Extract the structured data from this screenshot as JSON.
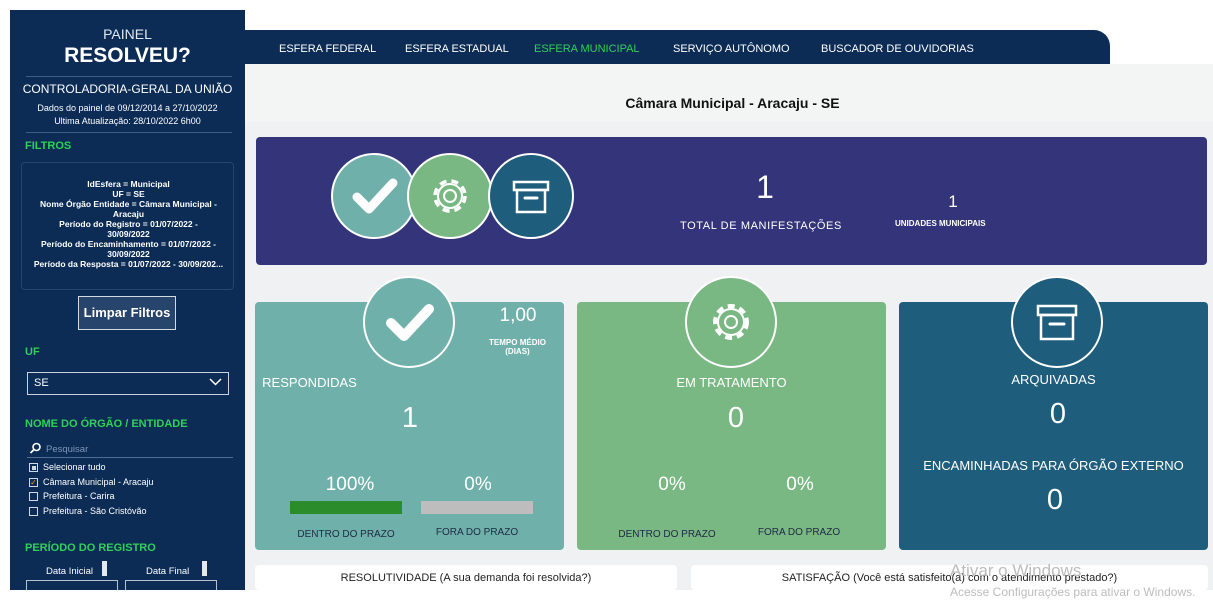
{
  "sidebar": {
    "title_top": "PAINEL",
    "title_main": "RESOLVEU?",
    "org": "CONTROLADORIA-GERAL DA UNIÃO",
    "dates_line1": "Dados do painel de 09/12/2014 a 27/10/2022",
    "dates_line2": "Ultima Atualização: 28/10/2022 6h00",
    "filters_label": "FILTROS",
    "filter_lines": [
      "IdEsfera = Municipal",
      "UF = SE",
      "Nome Órgão Entidade = Câmara Municipal -",
      "Aracaju",
      "Período do Registro = 01/07/2022 -",
      "30/09/2022",
      "Período do Encaminhamento = 01/07/2022 -",
      "30/09/2022",
      "Período da Resposta = 01/07/2022 - 30/09/202..."
    ],
    "clear_button": "Limpar Filtros",
    "uf_label": "UF",
    "uf_value": "SE",
    "org_label": "NOME DO ÓRGÃO / ENTIDADE",
    "search_placeholder": "Pesquisar",
    "org_items": [
      {
        "label": "Selecionar tudo",
        "state": "partial"
      },
      {
        "label": "Câmara Municipal - Aracaju",
        "state": "checked"
      },
      {
        "label": "Prefeitura - Carira",
        "state": "unchecked"
      },
      {
        "label": "Prefeitura - São Cristóvão",
        "state": "unchecked"
      }
    ],
    "period_label": "PERÍODO DO REGISTRO",
    "date_start_label": "Data Inicial",
    "date_end_label": "Data Final"
  },
  "tabs": [
    {
      "label": "ESFERA FEDERAL",
      "active": false
    },
    {
      "label": "ESFERA ESTADUAL",
      "active": false
    },
    {
      "label": "ESFERA MUNICIPAL",
      "active": true
    },
    {
      "label": "SERVIÇO AUTÔNOMO",
      "active": false
    },
    {
      "label": "BUSCADOR DE OUVIDORIAS",
      "active": false
    }
  ],
  "page_title": "Câmara Municipal - Aracaju - SE",
  "banner": {
    "total_value": "1",
    "total_label": "TOTAL DE MANIFESTAÇÕES",
    "units_value": "1",
    "units_label": "UNIDADES MUNICIPAIS"
  },
  "cards": {
    "respondidas": {
      "avg_time": "1,00",
      "avg_time_label_1": "TEMPO MÉDIO",
      "avg_time_label_2": "(DIAS)",
      "title": "RESPONDIDAS",
      "value": "1",
      "in_pct": "100%",
      "out_pct": "0%",
      "in_label": "DENTRO DO PRAZO",
      "out_label": "FORA DO PRAZO",
      "in_fill": 1.0,
      "out_fill": 0.0
    },
    "tratamento": {
      "title": "EM TRATAMENTO",
      "value": "0",
      "in_pct": "0%",
      "out_pct": "0%",
      "in_label": "DENTRO DO PRAZO",
      "out_label": "FORA DO PRAZO"
    },
    "arquivadas": {
      "title": "ARQUIVADAS",
      "value": "0",
      "sub_title": "ENCAMINHADAS PARA ÓRGÃO EXTERNO",
      "sub_value": "0"
    }
  },
  "bottom": {
    "resolutividade": "RESOLUTIVIDADE (A sua demanda foi resolvida?)",
    "satisfacao": "SATISFAÇÃO (Você está satisfeito(a) com o atendimento prestado?)"
  },
  "watermark": {
    "line1": "Ativar o Windows",
    "line2": "Acesse Configurações para ativar o Windows."
  },
  "colors": {
    "sidebar": "#0c2c56",
    "accent_green": "#2fd158",
    "banner": "#34347a",
    "card_respondidas": "#6fb0aa",
    "card_tratamento": "#79b783",
    "card_arquivadas": "#1e5d7c"
  },
  "icons": [
    "check-icon",
    "gear-icon",
    "archive-box-icon",
    "search-icon",
    "chevron-down-icon"
  ]
}
